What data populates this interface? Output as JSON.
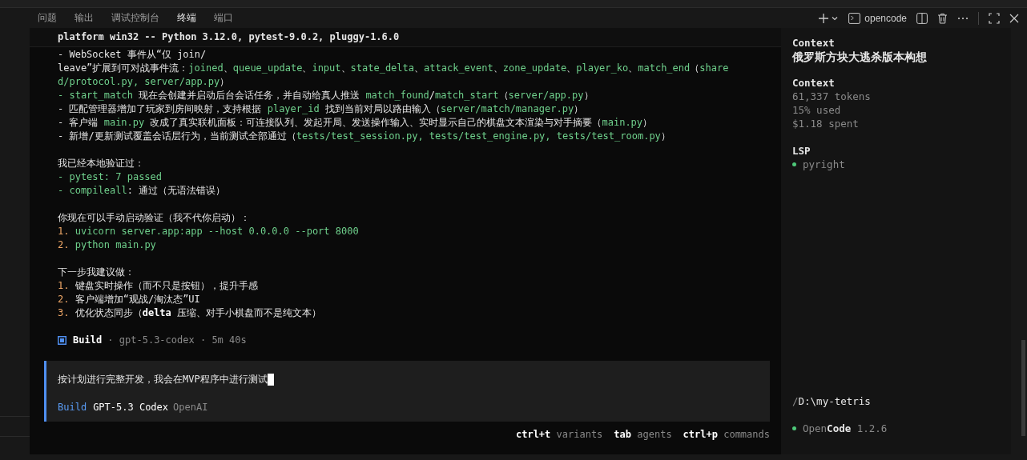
{
  "panel_tabs": [
    {
      "label": "问题",
      "selected": false
    },
    {
      "label": "输出",
      "selected": false
    },
    {
      "label": "调试控制台",
      "selected": false
    },
    {
      "label": "终端",
      "selected": true
    },
    {
      "label": "端口",
      "selected": false
    }
  ],
  "toolbar": {
    "terminal_name": "opencode"
  },
  "header_line": "platform win32 -- Python 3.12.0, pytest-9.0.2, pluggy-1.6.0",
  "paragraphs": [
    {
      "lines": [
        [
          {
            "kind": "text",
            "text": "- WebSocket 事件从“仅 join/"
          }
        ],
        [
          {
            "kind": "text",
            "text": "leave”扩展到可对战事件流："
          },
          {
            "kind": "code",
            "text": "joined"
          },
          {
            "kind": "text",
            "text": "、"
          },
          {
            "kind": "code",
            "text": "queue_update"
          },
          {
            "kind": "text",
            "text": "、"
          },
          {
            "kind": "code",
            "text": "input"
          },
          {
            "kind": "text",
            "text": "、"
          },
          {
            "kind": "code",
            "text": "state_delta"
          },
          {
            "kind": "text",
            "text": "、"
          },
          {
            "kind": "code",
            "text": "attack_event"
          },
          {
            "kind": "text",
            "text": "、"
          },
          {
            "kind": "code",
            "text": "zone_update"
          },
          {
            "kind": "text",
            "text": "、"
          },
          {
            "kind": "code",
            "text": "player_ko"
          },
          {
            "kind": "text",
            "text": "、"
          },
          {
            "kind": "code",
            "text": "match_end"
          },
          {
            "kind": "text",
            "text": "（"
          },
          {
            "kind": "code",
            "text": "share"
          }
        ],
        [
          {
            "kind": "code",
            "text": "d/protocol.py, server/app.py"
          },
          {
            "kind": "text",
            "text": "）"
          }
        ],
        [
          {
            "kind": "code",
            "text": "- start_match"
          },
          {
            "kind": "text",
            "text": " 现在会创建并启动后台会话任务，并自动给真人推送 "
          },
          {
            "kind": "code",
            "text": "match_found"
          },
          {
            "kind": "text",
            "text": "/"
          },
          {
            "kind": "code",
            "text": "match_start"
          },
          {
            "kind": "text",
            "text": "（"
          },
          {
            "kind": "code",
            "text": "server/app.py"
          },
          {
            "kind": "text",
            "text": "）"
          }
        ],
        [
          {
            "kind": "text",
            "text": "- 匹配管理器增加了玩家到房间映射，支持根据 "
          },
          {
            "kind": "code",
            "text": "player_id"
          },
          {
            "kind": "text",
            "text": " 找到当前对局以路由输入（"
          },
          {
            "kind": "code",
            "text": "server/match/manager.py"
          },
          {
            "kind": "text",
            "text": "）"
          }
        ],
        [
          {
            "kind": "text",
            "text": "- 客户端 "
          },
          {
            "kind": "code",
            "text": "main.py"
          },
          {
            "kind": "text",
            "text": " 改成了真实联机面板：可连接队列、发起开局、发送操作输入、实时显示自己的棋盘文本渲染与对手摘要（"
          },
          {
            "kind": "code",
            "text": "main.py"
          },
          {
            "kind": "text",
            "text": "）"
          }
        ],
        [
          {
            "kind": "text",
            "text": "- 新增/更新测试覆盖会话层行为，当前测试全部通过（"
          },
          {
            "kind": "code",
            "text": "tests/test_session.py, tests/test_engine.py, tests/test_room.py"
          },
          {
            "kind": "text",
            "text": "）"
          }
        ]
      ]
    },
    {
      "lines": [
        [
          {
            "kind": "text",
            "text": "我已经本地验证过："
          }
        ],
        [
          {
            "kind": "code",
            "text": "- pytest: 7 passed"
          }
        ],
        [
          {
            "kind": "code",
            "text": "- compileall"
          },
          {
            "kind": "text",
            "text": ": 通过（无语法错误）"
          }
        ]
      ]
    },
    {
      "lines": [
        [
          {
            "kind": "text",
            "text": "你现在可以手动启动验证（我不代你启动）："
          }
        ],
        [
          {
            "kind": "num",
            "text": "1. "
          },
          {
            "kind": "code",
            "text": "uvicorn server.app:app --host 0.0.0.0 --port 8000"
          }
        ],
        [
          {
            "kind": "num",
            "text": "2. "
          },
          {
            "kind": "code",
            "text": "python main.py"
          }
        ]
      ]
    },
    {
      "lines": [
        [
          {
            "kind": "text",
            "text": "下一步我建议做："
          }
        ],
        [
          {
            "kind": "num",
            "text": "1. "
          },
          {
            "kind": "text",
            "text": "键盘实时操作（而不只是按钮），提升手感"
          }
        ],
        [
          {
            "kind": "num",
            "text": "2. "
          },
          {
            "kind": "text",
            "text": "客户端增加“观战/淘汰态”UI"
          }
        ],
        [
          {
            "kind": "num",
            "text": "3. "
          },
          {
            "kind": "text",
            "text": "优化状态同步（"
          },
          {
            "kind": "strong",
            "text": "delta"
          },
          {
            "kind": "text",
            "text": " 压缩、对手小棋盘而不是纯文本）"
          }
        ]
      ]
    }
  ],
  "build_status": [
    {
      "kind": "strong",
      "text": "Build"
    },
    {
      "kind": "dim",
      "text": " · gpt-5.3-codex · 5m 40s"
    }
  ],
  "prompt": {
    "value": "按计划进行完整开发，我会在MVP程序中进行测试",
    "agent": "Build",
    "model": "GPT-5.3 Codex",
    "provider": "OpenAI"
  },
  "hints": [
    {
      "key": "ctrl+t",
      "label": "variants"
    },
    {
      "key": "tab",
      "label": "agents"
    },
    {
      "key": "ctrl+p",
      "label": "commands"
    }
  ],
  "sidebar": {
    "heading": "Context",
    "session_title": "俄罗斯方块大逃杀版本构想",
    "context": {
      "heading": "Context",
      "lines": [
        "61,337 tokens",
        "15% used",
        "$1.18 spent"
      ]
    },
    "lsp": {
      "heading": "LSP",
      "servers": [
        {
          "name": "pyright",
          "color": "#4ec97a"
        }
      ]
    },
    "path_prefix": "/",
    "path": "D:\\my-tetris",
    "app": {
      "name_dim": "Open",
      "name_bold": "Code",
      "version": "1.2.6",
      "color": "#4ec97a"
    }
  }
}
